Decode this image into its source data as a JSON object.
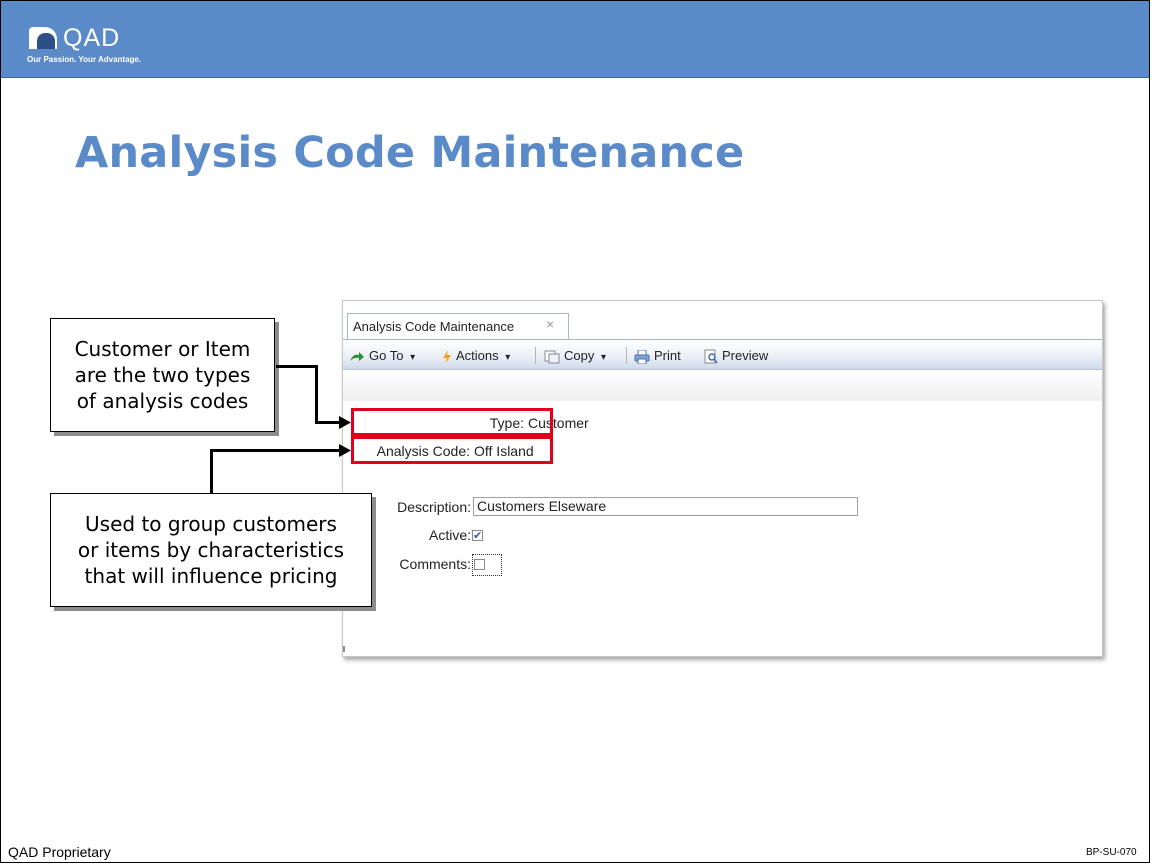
{
  "logo": {
    "text": "QAD",
    "tagline": "Our Passion. Your Advantage."
  },
  "slide": {
    "title": "Analysis Code Maintenance"
  },
  "window": {
    "tab_label": "Analysis Code Maintenance",
    "tab_close": "×",
    "toolbar": {
      "goto": "Go To",
      "actions": "Actions",
      "copy": "Copy",
      "print": "Print",
      "preview": "Preview",
      "dropdown": "▾"
    },
    "fields": {
      "type_label": "Type:",
      "type_value": "Customer",
      "code_label": "Analysis Code:",
      "code_value": "Off Island",
      "description_label": "Description:",
      "description_value": "Customers Elseware",
      "active_label": "Active:",
      "active_checked": "✔",
      "comments_label": "Comments:"
    }
  },
  "callouts": {
    "types": [
      "Customer or Item",
      "are the two types",
      "of analysis codes"
    ],
    "group": [
      "Used to group customers",
      "or items by characteristics",
      "that will influence pricing"
    ]
  },
  "colors": {
    "banner": "#5b8ac9",
    "title": "#5b8ac9",
    "highlight": "#e2001a"
  },
  "footer": {
    "left": "QAD Proprietary",
    "right": "BP-SU-070"
  }
}
